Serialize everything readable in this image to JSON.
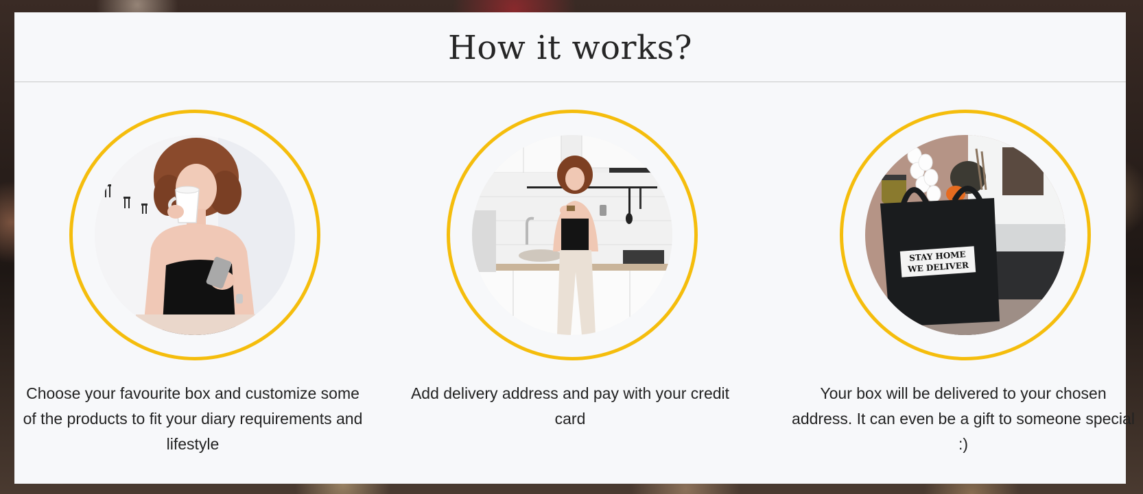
{
  "section": {
    "title": "How it works?"
  },
  "steps": [
    {
      "image": "woman-drinking-coffee-with-phone-photo",
      "text": "Choose your favourite box and customize some of the products to fit your diary requirements and lifestyle"
    },
    {
      "image": "woman-in-kitchen-paying-with-card-photo",
      "text": "Add delivery address and pay with your credit card"
    },
    {
      "image": "delivery-bag-with-groceries-photo",
      "text": "Your box will be delivered to your chosen address. It can even be a gift to someone special :)",
      "bag_text": "STAY HOME WE DELIVER"
    }
  ],
  "colors": {
    "ring": "#f5bd0c",
    "panel": "#f7f8fa",
    "text": "#222222"
  }
}
